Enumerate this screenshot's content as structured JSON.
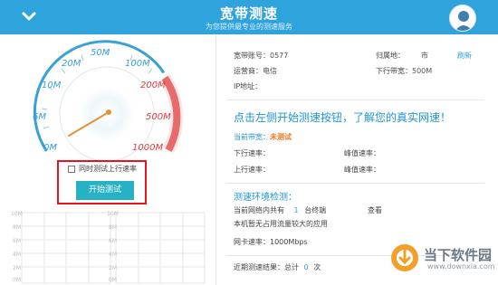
{
  "header": {
    "title": "宽带测速",
    "subtitle": "为您提供最专业的测速服务"
  },
  "gauge": {
    "tick_labels": [
      "0M",
      "6M",
      "10M",
      "20M",
      "50M",
      "100M",
      "200M",
      "500M",
      "1000M"
    ],
    "needle_value_mbps": 0
  },
  "controls": {
    "upload_checkbox_label": "同时测试上行速率",
    "start_button_label": "开始测试"
  },
  "graph": {
    "y_labels": [
      "10M",
      "8M",
      "6M",
      "4M",
      "2M",
      "0M"
    ]
  },
  "account": {
    "account_label": "宽带账号：",
    "account_value": "0577",
    "region_label": "归属地：",
    "region_value": "市",
    "refresh_label": "刷新",
    "isp_label": "运营商：",
    "isp_value": "电信",
    "down_bw_label": "下行带宽：",
    "down_bw_value": "500M",
    "ip_label": "IP地址："
  },
  "prompt": "点击左侧开始测速按钮，了解您的真实网速！",
  "status": {
    "current_bw_label": "当前带宽：",
    "current_bw_value": "未测试",
    "down_rate_label": "下行速率：",
    "peak_rate_label": "峰值速率：",
    "up_rate_label": "上行速率："
  },
  "env": {
    "title": "测速环境检测：",
    "devices_prefix": "当前网络内共有",
    "devices_count": "1",
    "devices_suffix": "台终端",
    "view_label": "查看",
    "no_heavy_apps": "本机暂无占用流量较大的应用",
    "nic_rate": "网卡速率：1000Mbps"
  },
  "history": {
    "label": "近期测速结果：总计",
    "count": "0",
    "unit": "次"
  },
  "watermark": {
    "text": "当下软件园",
    "url": "www.downxia.com"
  },
  "colors": {
    "header_blue": "#2fa3dc",
    "gauge_blue": "#38a1d6",
    "gauge_red": "#e23a3a",
    "button_teal": "#27b1c4",
    "highlight_red": "#e8141d",
    "orange": "#ee7a1d"
  }
}
